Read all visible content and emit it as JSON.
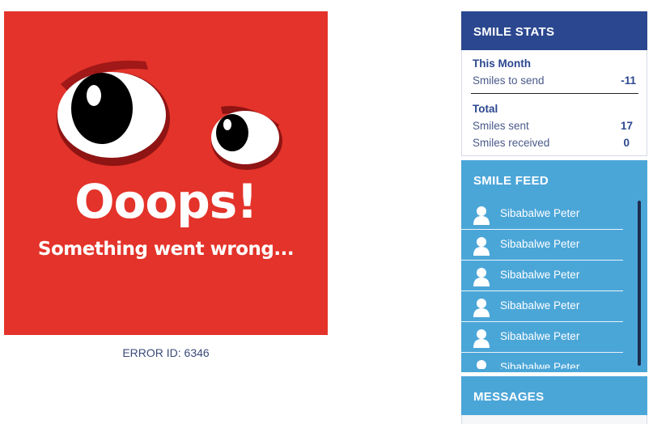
{
  "error": {
    "headline": "Ooops!",
    "subline": "Something went wrong...",
    "error_id": "ERROR ID: 6346"
  },
  "smile_stats": {
    "title": "SMILE STATS",
    "this_month": {
      "heading": "This Month",
      "rows": [
        {
          "label": "Smiles to send",
          "value": "-11"
        }
      ]
    },
    "total": {
      "heading": "Total",
      "rows": [
        {
          "label": "Smiles sent",
          "value": "17"
        },
        {
          "label": "Smiles received",
          "value": "0"
        }
      ]
    }
  },
  "smile_feed": {
    "title": "SMILE FEED",
    "items": [
      {
        "name": "Sibabalwe Peter",
        "icon": "user-icon"
      },
      {
        "name": "Sibabalwe Peter",
        "icon": "user-icon"
      },
      {
        "name": "Sibabalwe Peter",
        "icon": "user-icon"
      },
      {
        "name": "Sibabalwe Peter",
        "icon": "user-icon"
      },
      {
        "name": "Sibabalwe Peter",
        "icon": "user-icon"
      },
      {
        "name": "Sibabalwe Peter",
        "icon": "user-icon"
      }
    ]
  },
  "messages": {
    "title": "MESSAGES"
  },
  "colors": {
    "error_bg": "#e3332a",
    "stats_header": "#2b478f",
    "feed_bg": "#4ba6d8"
  }
}
